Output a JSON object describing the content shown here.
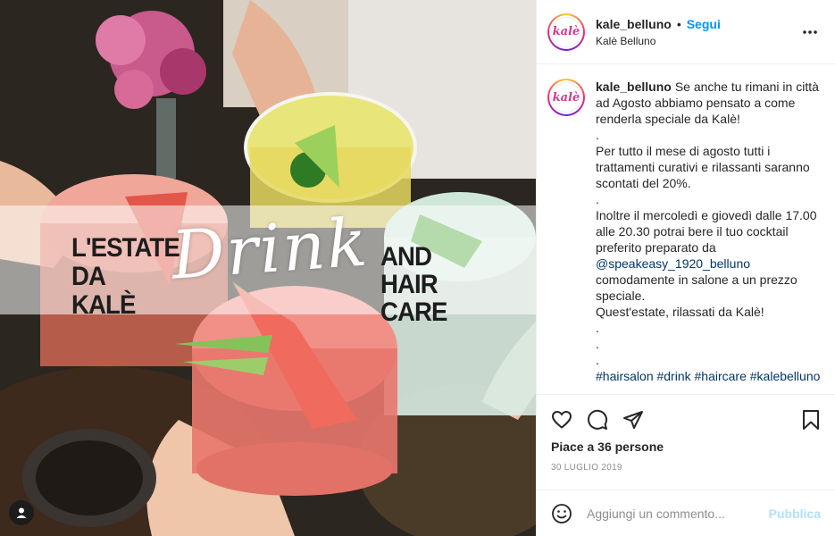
{
  "image": {
    "banner_left": [
      "L'ESTATE",
      "DA KALÈ"
    ],
    "banner_script": "Drink",
    "banner_right": [
      "AND",
      "HAIR CARE"
    ]
  },
  "header": {
    "avatar_text": "kalè",
    "username": "kale_belluno",
    "separator": "•",
    "follow_label": "Segui",
    "location": "Kalè Belluno",
    "more_icon": "more-horizontal-icon"
  },
  "caption": {
    "username": "kale_belluno",
    "lines": [
      "Se anche tu rimani in città ad Agosto abbiamo pensato a come renderla speciale da Kalè!",
      ".",
      "Per tutto il mese di agosto tutti i trattamenti curativi e rilassanti saranno scontati del 20%.",
      ".",
      "Inoltre il mercoledì e giovedì dalle 17.00 alle 20.30 potrai bere il tuo cocktail preferito preparato da",
      "@speakeasy_1920_belluno",
      "comodamente in salone a un prezzo speciale.",
      "Quest'estate, rilassati da Kalè!",
      ".",
      ".",
      ".",
      "#hairsalon #drink #haircare #kalebelluno"
    ]
  },
  "actions": {
    "like_icon": "heart-icon",
    "comment_icon": "comment-icon",
    "share_icon": "send-icon",
    "save_icon": "bookmark-icon",
    "likes_text": "Piace a 36 persone",
    "date_text": "30 LUGLIO 2019"
  },
  "add_comment": {
    "emoji_icon": "smiley-icon",
    "placeholder": "Aggiungi un commento...",
    "publish_label": "Pubblica"
  },
  "colors": {
    "accent": "#0095f6",
    "link": "#00376b",
    "publish_disabled": "#b2dffc"
  }
}
